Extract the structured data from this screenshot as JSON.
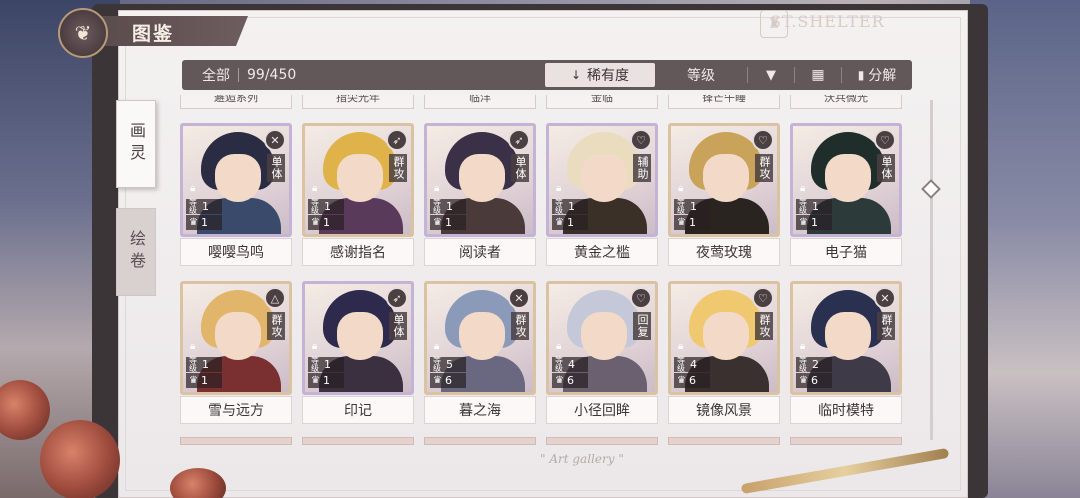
{
  "header": {
    "title": "图鉴",
    "emblem_icon": "butterfly-icon"
  },
  "brand": "ST.SHELTER",
  "toolbar": {
    "all": "全部",
    "count": "99/450",
    "sort_rarity": "稀有度",
    "sort_level": "等级",
    "filter_icon": "filter-icon",
    "grid_icon": "grid-view-icon",
    "decompose": "分解"
  },
  "side_tabs": [
    {
      "label": "画灵",
      "active": true
    },
    {
      "label": "绘卷",
      "active": false
    }
  ],
  "partial_top": [
    "邂逅系列",
    "指尖光年",
    "临洋",
    "金临",
    "锋芒午睡",
    "沃兵微光"
  ],
  "rows": [
    [
      {
        "name": "嘤嘤鸟鸣",
        "type": "单体",
        "level": "1",
        "stars": "1",
        "badge": "cross-icon",
        "rarity": "purple",
        "hair": "#2a2c44",
        "outfit": "#3a4a6a"
      },
      {
        "name": "感谢指名",
        "type": "群攻",
        "level": "1",
        "stars": "1",
        "badge": "rocket-icon",
        "rarity": "gold",
        "hair": "#e0b34a",
        "outfit": "#5a3a5a"
      },
      {
        "name": "阅读者",
        "type": "单体",
        "level": "1",
        "stars": "1",
        "badge": "rocket-icon",
        "rarity": "purple",
        "hair": "#3a3048",
        "outfit": "#4a3a3a"
      },
      {
        "name": "黄金之槛",
        "type": "辅助",
        "level": "1",
        "stars": "1",
        "badge": "heart-icon",
        "rarity": "purple",
        "hair": "#e9dcbf",
        "outfit": "#3a3028"
      },
      {
        "name": "夜莺玫瑰",
        "type": "群攻",
        "level": "1",
        "stars": "1",
        "badge": "heart-icon",
        "rarity": "gold",
        "hair": "#c9a35a",
        "outfit": "#2a2420"
      },
      {
        "name": "电子猫",
        "type": "单体",
        "level": "1",
        "stars": "1",
        "badge": "heart-icon",
        "rarity": "purple",
        "hair": "#1f2e2a",
        "outfit": "#2c3b3a"
      }
    ],
    [
      {
        "name": "雪与远方",
        "type": "群攻",
        "level": "1",
        "stars": "1",
        "badge": "triangle-icon",
        "rarity": "gold",
        "hair": "#e2b66a",
        "outfit": "#7a3030"
      },
      {
        "name": "印记",
        "type": "单体",
        "level": "1",
        "stars": "1",
        "badge": "rocket-icon",
        "rarity": "purple",
        "hair": "#2e2a4e",
        "outfit": "#3a3040"
      },
      {
        "name": "暮之海",
        "type": "群攻",
        "level": "5",
        "stars": "6",
        "badge": "cross-icon",
        "rarity": "gold",
        "hair": "#8a9ab8",
        "outfit": "#6a6880"
      },
      {
        "name": "小径回眸",
        "type": "回复",
        "level": "4",
        "stars": "6",
        "badge": "heart-icon",
        "rarity": "gold",
        "hair": "#c5c8d8",
        "outfit": "#6a6070"
      },
      {
        "name": "镜像风景",
        "type": "群攻",
        "level": "4",
        "stars": "6",
        "badge": "heart-icon",
        "rarity": "gold",
        "hair": "#f0c870",
        "outfit": "#3a3030"
      },
      {
        "name": "临时模特",
        "type": "群攻",
        "level": "2",
        "stars": "6",
        "badge": "cross-icon",
        "rarity": "gold",
        "hair": "#2a3050",
        "outfit": "#3e3a48"
      }
    ]
  ],
  "stat_labels": {
    "level_key": "等级",
    "lock_icon": "lock-icon",
    "star_icon": "crown-icon"
  },
  "footer": "\" Art gallery \""
}
